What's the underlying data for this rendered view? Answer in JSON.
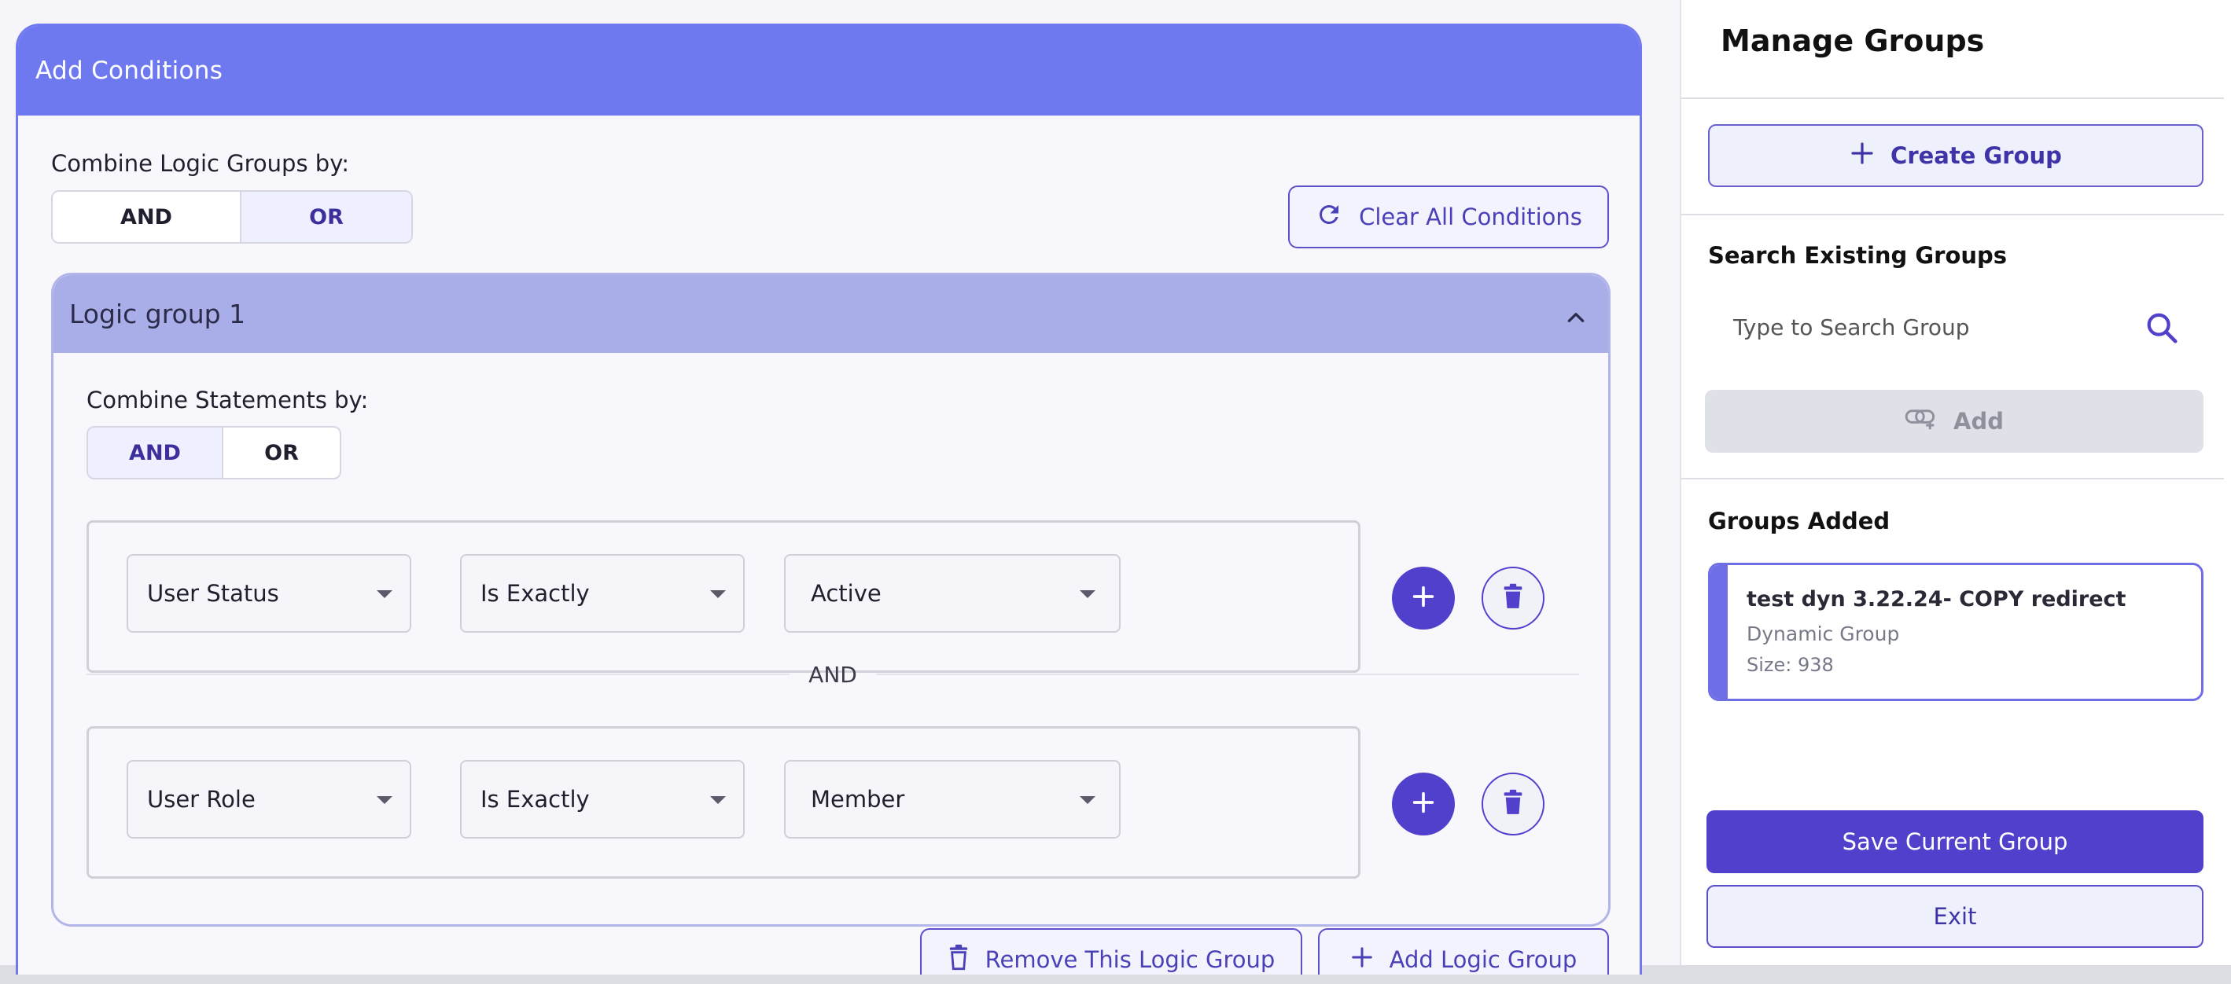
{
  "conditions": {
    "header_title": "Add Conditions",
    "combine_groups_label": "Combine Logic Groups by:",
    "combine_groups_options": [
      "AND",
      "OR"
    ],
    "combine_groups_selected": "OR",
    "clear_all_label": "Clear All Conditions",
    "logic_groups": [
      {
        "title": "Logic group 1",
        "combine_statements_label": "Combine Statements by:",
        "combine_statements_options": [
          "AND",
          "OR"
        ],
        "combine_statements_selected": "AND",
        "statement_separator": "AND",
        "statements": [
          {
            "field": "User Status",
            "operator": "Is Exactly",
            "value": "Active"
          },
          {
            "field": "User Role",
            "operator": "Is Exactly",
            "value": "Member"
          }
        ]
      }
    ],
    "remove_group_label": "Remove This Logic Group",
    "add_group_label": "Add Logic Group"
  },
  "sidebar": {
    "title": "Manage Groups",
    "create_group_label": "Create Group",
    "search_section_label": "Search Existing Groups",
    "search_placeholder": "Type to Search Group",
    "add_label": "Add",
    "groups_added_label": "Groups Added",
    "groups": [
      {
        "name": "test dyn 3.22.24- COPY redirect",
        "type": "Dynamic Group",
        "size": "Size: 938"
      }
    ],
    "save_label": "Save Current Group",
    "exit_label": "Exit"
  },
  "colors": {
    "primary": "#5140cc",
    "header": "#6f79ef",
    "logic_group_header": "#a9aee9"
  }
}
